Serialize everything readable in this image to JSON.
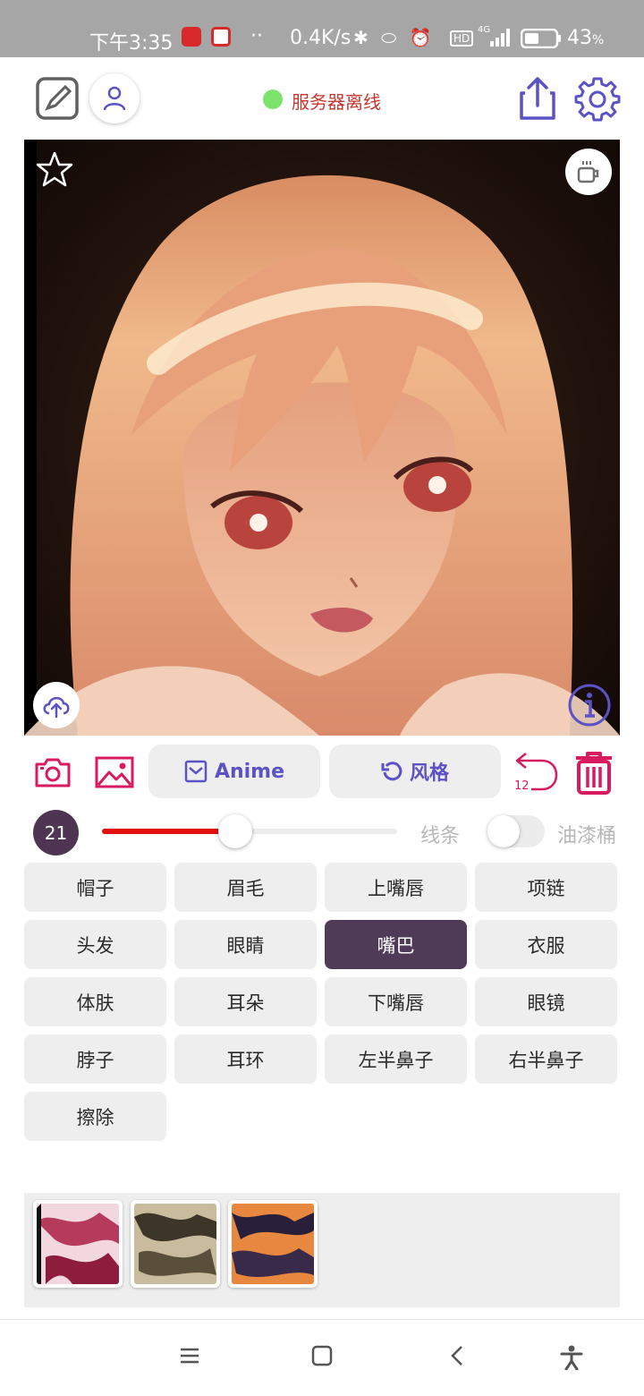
{
  "status_bar": {
    "time": "下午3:35",
    "network_speed": "0.4K/s",
    "signal": "4G",
    "hd": "HD",
    "battery": "43",
    "battery_unit": "%"
  },
  "header": {
    "server_status": "服务器离线",
    "status_color": "#7ee36c"
  },
  "toolbar": {
    "model_label": "Anime",
    "style_label": "风格",
    "undo_count": "12"
  },
  "brush": {
    "size": "21",
    "slider_fraction": 0.45,
    "line_label": "线条",
    "bucket_label": "油漆桶",
    "bucket_enabled": false
  },
  "parts": [
    {
      "label": "帽子",
      "active": false
    },
    {
      "label": "眉毛",
      "active": false
    },
    {
      "label": "上嘴唇",
      "active": false
    },
    {
      "label": "项链",
      "active": false
    },
    {
      "label": "头发",
      "active": false
    },
    {
      "label": "眼睛",
      "active": false
    },
    {
      "label": "嘴巴",
      "active": true
    },
    {
      "label": "衣服",
      "active": false
    },
    {
      "label": "体肤",
      "active": false
    },
    {
      "label": "耳朵",
      "active": false
    },
    {
      "label": "下嘴唇",
      "active": false
    },
    {
      "label": "眼镜",
      "active": false
    },
    {
      "label": "脖子",
      "active": false
    },
    {
      "label": "耳环",
      "active": false
    },
    {
      "label": "左半鼻子",
      "active": false
    },
    {
      "label": "右半鼻子",
      "active": false
    },
    {
      "label": "擦除",
      "active": false
    }
  ],
  "colors": {
    "accent": "#5a52c5",
    "danger": "#d81b60",
    "active_chip": "#4f3a57",
    "slider_fill": "#e30f0f"
  }
}
